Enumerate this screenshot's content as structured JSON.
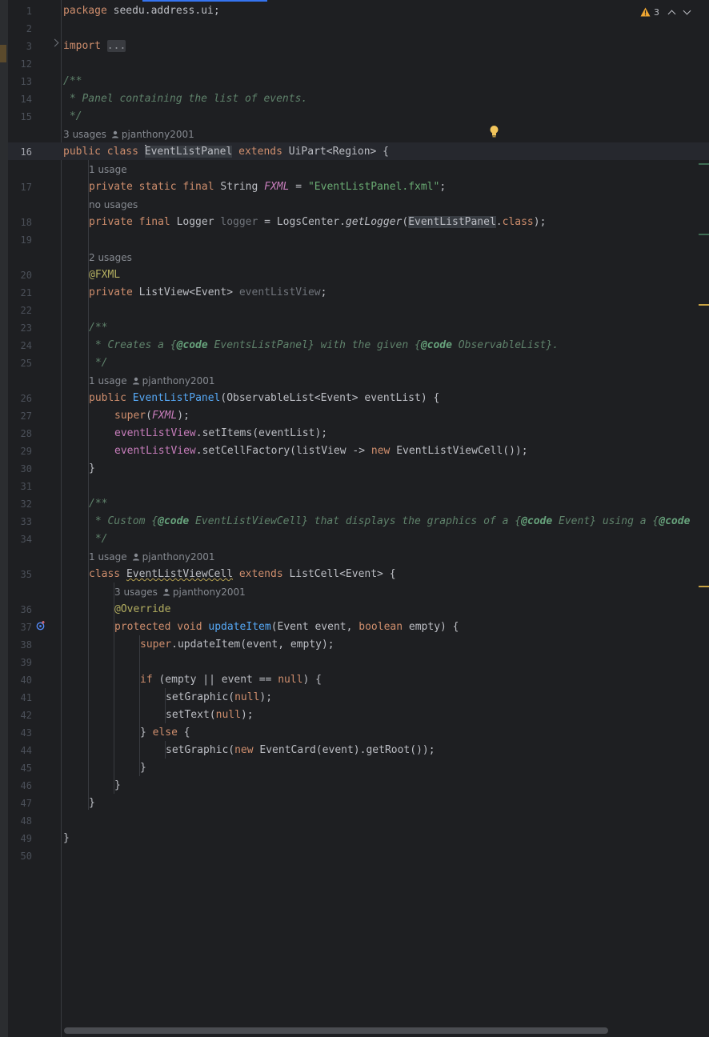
{
  "editor": {
    "inspections": {
      "warning_count": "3"
    },
    "hints": {
      "h1": {
        "usages": "3 usages",
        "author": "pjanthony2001"
      },
      "h2": {
        "usages": "1 usage"
      },
      "h3": {
        "usages": "no usages"
      },
      "h4": {
        "usages": "2 usages"
      },
      "h5": {
        "usages": "1 usage",
        "author": "pjanthony2001"
      },
      "h6": {
        "usages": "1 usage",
        "author": "pjanthony2001"
      },
      "h7": {
        "usages": "3 usages",
        "author": "pjanthony2001"
      }
    },
    "line_numbers": [
      "1",
      "2",
      "3",
      "12",
      "13",
      "14",
      "15",
      "16",
      "17",
      "18",
      "19",
      "20",
      "21",
      "22",
      "23",
      "24",
      "25",
      "26",
      "27",
      "28",
      "29",
      "30",
      "31",
      "32",
      "33",
      "34",
      "35",
      "36",
      "37",
      "38",
      "39",
      "40",
      "41",
      "42",
      "43",
      "44",
      "45",
      "46",
      "47",
      "48",
      "49",
      "50"
    ],
    "code": {
      "l1": {
        "kw": "package",
        "rest": " seedu.address.ui;"
      },
      "l3": {
        "kw": "import",
        "fold": "..."
      },
      "l13": "/**",
      "l14": " * Panel containing the list of events.",
      "l15": " */",
      "l16": {
        "kw": "public class",
        "sp": " ",
        "cls": "EventListPanel",
        "kw2": "extends",
        "rest": " UiPart<Region> {"
      },
      "l17": {
        "kw": "private static final",
        "t1": " String ",
        "fld": "FXML",
        "t2": " = ",
        "str": "\"EventListPanel.fxml\"",
        "t3": ";"
      },
      "l18": {
        "kw": "private final",
        "t1": " Logger ",
        "fld": "logger",
        "t2": " = LogsCenter.",
        "m": "getLogger",
        "t3": "(",
        "hl": "EventListPanel",
        "t4": ".",
        "kw2": "class",
        "t5": ");"
      },
      "l20": "@FXML",
      "l21": {
        "kw": "private",
        "t1": " ListView<Event> ",
        "fld": "eventListView",
        "t2": ";"
      },
      "l23": "/**",
      "l24": {
        "a": " * Creates a {",
        "tag1": "@code",
        "b": " EventsListPanel} with the given {",
        "tag2": "@code",
        "c": " ObservableList}."
      },
      "l25": " */",
      "l26": {
        "kw": "public",
        "sp": " ",
        "fn": "EventListPanel",
        "rest": "(ObservableList<Event> eventList) {"
      },
      "l27": {
        "kw": "super",
        "t1": "(",
        "fld": "FXML",
        "t2": ");"
      },
      "l28": {
        "fld": "eventListView",
        "rest": ".setItems(eventList);"
      },
      "l29": {
        "fld": "eventListView",
        "t1": ".setCellFactory(listView -> ",
        "kw": "new",
        "t2": " EventListViewCell());"
      },
      "l30": "}",
      "l32": "/**",
      "l33": {
        "a": " * Custom {",
        "tag1": "@code",
        "b": " EventListViewCell} that displays the graphics of a {",
        "tag2": "@code",
        "c": " Event} using a {",
        "tag3": "@code"
      },
      "l34": " */",
      "l35": {
        "kw": "class",
        "sp": " ",
        "cls": "EventListViewCell",
        "kw2": "extends",
        "rest": " ListCell<Event> {"
      },
      "l36": "@Override",
      "l37": {
        "kw": "protected void",
        "sp": " ",
        "fn": "updateItem",
        "t1": "(Event event, ",
        "kw2": "boolean",
        "t2": " empty) {"
      },
      "l38": {
        "kw": "super",
        "rest": ".updateItem(event, empty);"
      },
      "l40": {
        "kw": "if",
        "t1": " (empty || event == ",
        "kw2": "null",
        "t2": ") {"
      },
      "l41": {
        "t1": "setGraphic(",
        "kw": "null",
        "t2": ");"
      },
      "l42": {
        "t1": "setText(",
        "kw": "null",
        "t2": ");"
      },
      "l43": {
        "t1": "} ",
        "kw": "else",
        "t2": " {"
      },
      "l44": {
        "t1": "setGraphic(",
        "kw": "new",
        "t2": " EventCard(event).getRoot());"
      },
      "l45": "}",
      "l46": "}",
      "l47": "}",
      "l49": "}"
    }
  }
}
